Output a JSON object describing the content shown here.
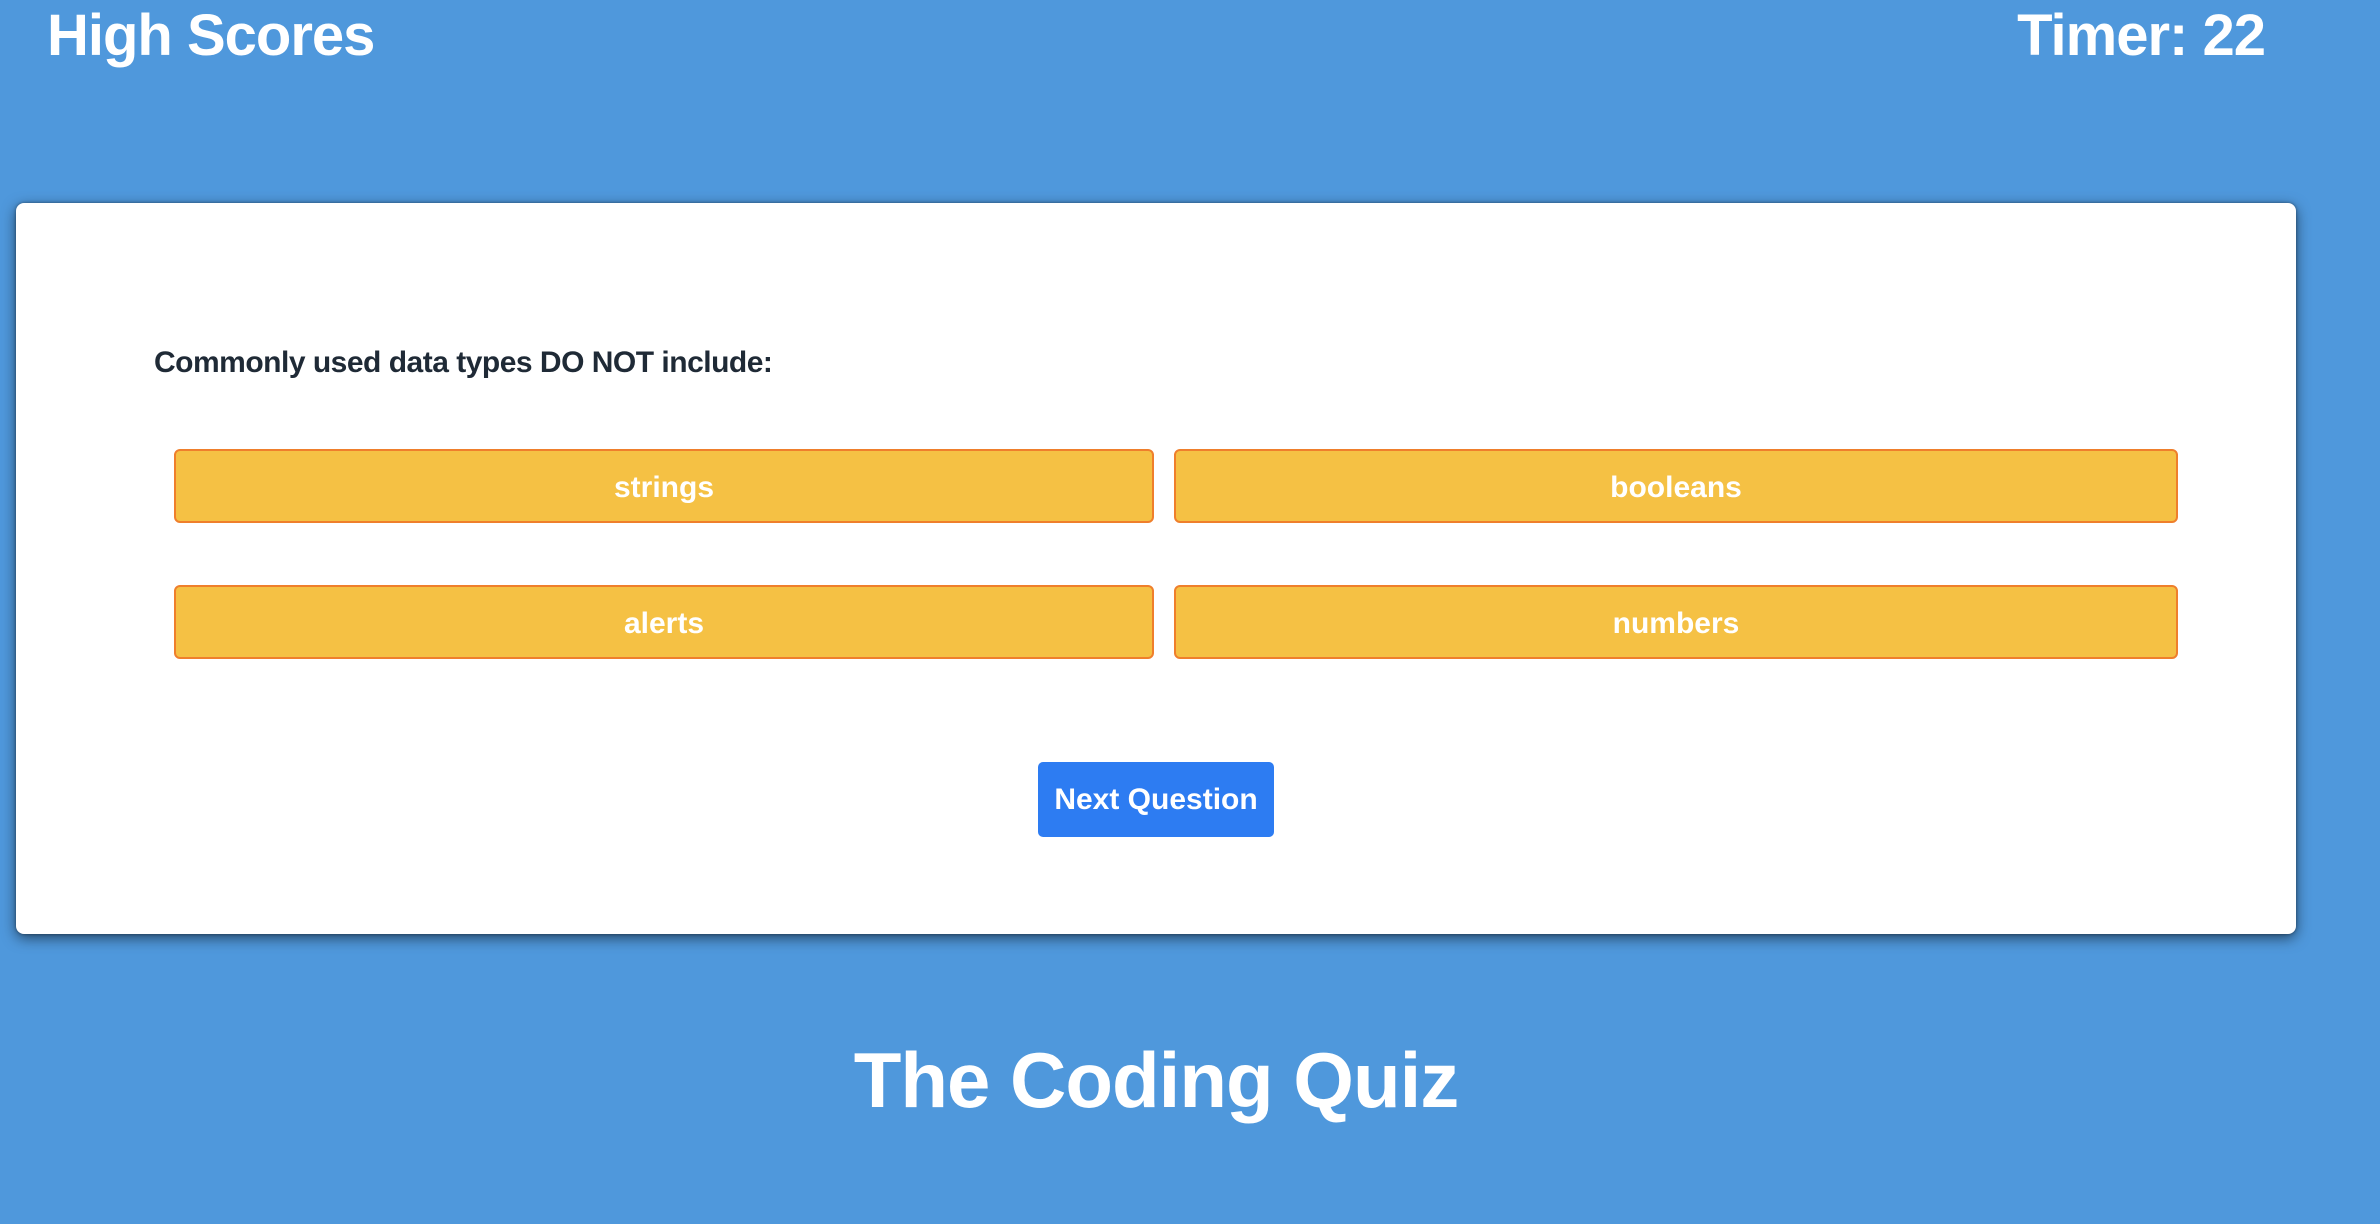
{
  "header": {
    "high_scores_label": "High Scores",
    "timer_text": "Timer: 22"
  },
  "quiz": {
    "question": "Commonly used data types DO NOT include:",
    "answers": [
      "strings",
      "booleans",
      "alerts",
      "numbers"
    ],
    "next_label": "Next Question"
  },
  "footer": {
    "title": "The Coding Quiz"
  },
  "colors": {
    "background": "#4f98dc",
    "answer_fill": "#f5c144",
    "answer_border": "#ef7f2c",
    "next_button": "#2d7cf2",
    "card": "#ffffff"
  }
}
